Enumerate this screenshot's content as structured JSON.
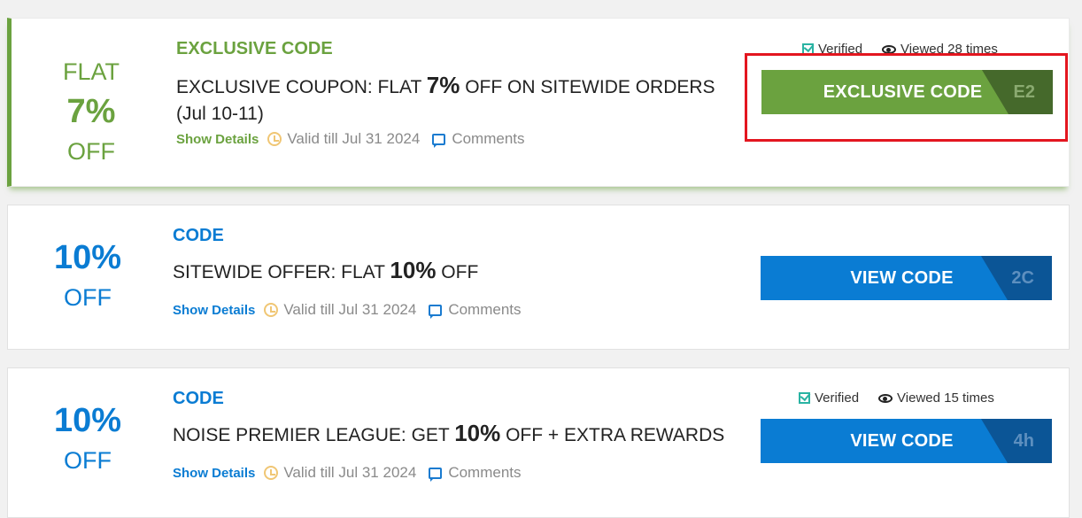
{
  "offers": [
    {
      "discount": {
        "top": "FLAT",
        "big": "7%",
        "bottom": "OFF"
      },
      "type_label": "EXCLUSIVE CODE",
      "title_pre": "EXCLUSIVE COUPON: FLAT ",
      "title_bold": "7%",
      "title_post": " OFF ON SITEWIDE ORDERS (Jul 10-11)",
      "show_details": "Show Details",
      "valid": "Valid till Jul 31 2024",
      "comments": "Comments",
      "verified": "Verified",
      "viewed": "Viewed 28 times",
      "button_label": "EXCLUSIVE CODE",
      "code_peek": "E2",
      "accent_color": "#6ba23f"
    },
    {
      "discount": {
        "top": "",
        "big": "10%",
        "bottom": "OFF"
      },
      "type_label": "CODE",
      "title_pre": "SITEWIDE OFFER: FLAT ",
      "title_bold": "10%",
      "title_post": " OFF",
      "show_details": "Show Details",
      "valid": "Valid till Jul 31 2024",
      "comments": "Comments",
      "button_label": "VIEW CODE",
      "code_peek": "2C",
      "accent_color": "#0a7cd3"
    },
    {
      "discount": {
        "top": "",
        "big": "10%",
        "bottom": "OFF"
      },
      "type_label": "CODE",
      "title_pre": "NOISE PREMIER LEAGUE: GET ",
      "title_bold": "10%",
      "title_post": " OFF + EXTRA REWARDS",
      "show_details": "Show Details",
      "valid": "Valid till Jul 31 2024",
      "comments": "Comments",
      "verified": "Verified",
      "viewed": "Viewed 15 times",
      "button_label": "VIEW CODE",
      "code_peek": "4h",
      "accent_color": "#0a7cd3"
    }
  ],
  "highlight_color": "#e3161f"
}
